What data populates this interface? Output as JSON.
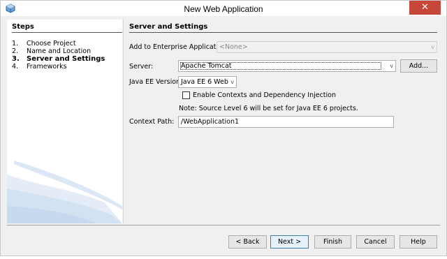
{
  "window": {
    "title": "New Web Application",
    "close_symbol": "✕"
  },
  "steps": {
    "heading": "Steps",
    "items": [
      {
        "num": "1.",
        "label": "Choose Project",
        "current": false
      },
      {
        "num": "2.",
        "label": "Name and Location",
        "current": false
      },
      {
        "num": "3.",
        "label": "Server and Settings",
        "current": true
      },
      {
        "num": "4.",
        "label": "Frameworks",
        "current": false
      }
    ]
  },
  "main": {
    "heading": "Server and Settings",
    "enterprise_label": "Add to Enterprise Application:",
    "enterprise_value": "<None>",
    "server_label": "Server:",
    "server_value": "Apache Tomcat",
    "add_label": "Add...",
    "javaee_label": "Java EE Version:",
    "javaee_value": "Java EE 6 Web",
    "cdi_label": "Enable Contexts and Dependency Injection",
    "cdi_checked": false,
    "note": "Note: Source Level 6 will be set for Java EE 6 projects.",
    "context_label": "Context Path:",
    "context_value": "/WebApplication1"
  },
  "buttons": {
    "back": "< Back",
    "next": "Next >",
    "finish": "Finish",
    "cancel": "Cancel",
    "help": "Help"
  },
  "icons": {
    "dropdown_arrow": "v",
    "app_icon": "netbeans-cube-icon"
  }
}
